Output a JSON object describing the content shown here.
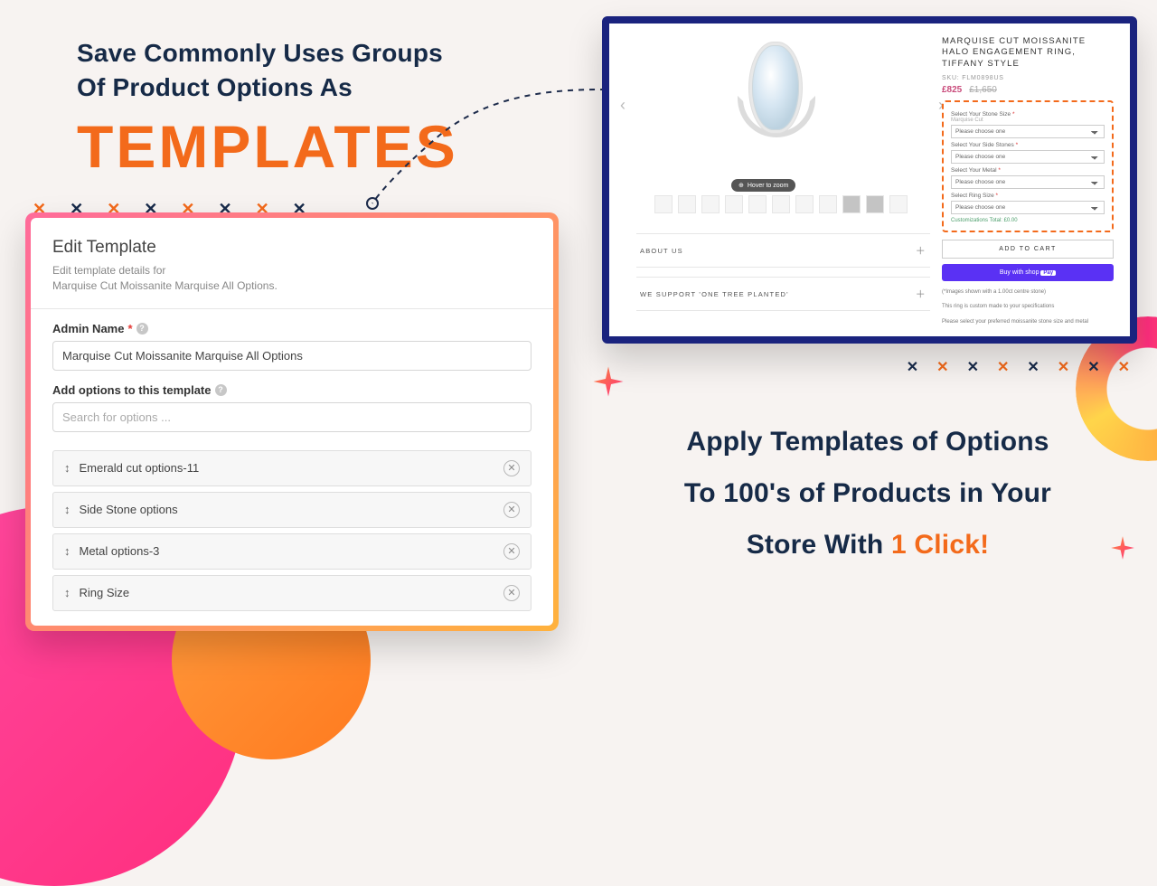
{
  "headline": {
    "line1": "Save Commonly Uses Groups",
    "line2": "Of Product Options As",
    "big": "TEMPLATES"
  },
  "admin": {
    "title": "Edit Template",
    "subtitle1": "Edit template details for",
    "subtitle2": "Marquise Cut Moissanite Marquise All Options.",
    "name_label": "Admin Name",
    "name_value": "Marquise Cut Moissanite Marquise All Options",
    "add_label": "Add options to this template",
    "search_placeholder": "Search for options ...",
    "options": [
      "Emerald cut options-11",
      "Side Stone options",
      "Metal options-3",
      "Ring Size"
    ]
  },
  "store": {
    "hover": "Hover to zoom",
    "accordion": [
      "ABOUT US",
      "WE SUPPORT 'ONE TREE PLANTED'"
    ],
    "title": "MARQUISE CUT MOISSANITE HALO ENGAGEMENT RING, TIFFANY STYLE",
    "sku_label": "SKU: FLM0898US",
    "price_current": "£825",
    "price_old": "£1,650",
    "opt_labels": {
      "size": "Select Your Stone Size",
      "size_sub": "Marquise Cut",
      "side": "Select Your Side Stones",
      "metal": "Select Your Metal",
      "ring": "Select Ring Size"
    },
    "select_placeholder": "Please choose one",
    "cust_total": "Customizations Total: £0.00",
    "atc": "ADD TO CART",
    "shoppay_prefix": "Buy with ",
    "shoppay_brand": "shop",
    "shoppay_suffix": "Pay",
    "note1": "(*Images shown with a 1.00ct centre stone)",
    "note2": "This ring is custom made to your specifications",
    "note3": "Please select your preferred moissanite stone size and metal"
  },
  "bottom": {
    "l1": "Apply Templates of Options",
    "l2": "To 100's of Products in Your",
    "l3_a": "Store With ",
    "l3_b": "1 Click!"
  }
}
